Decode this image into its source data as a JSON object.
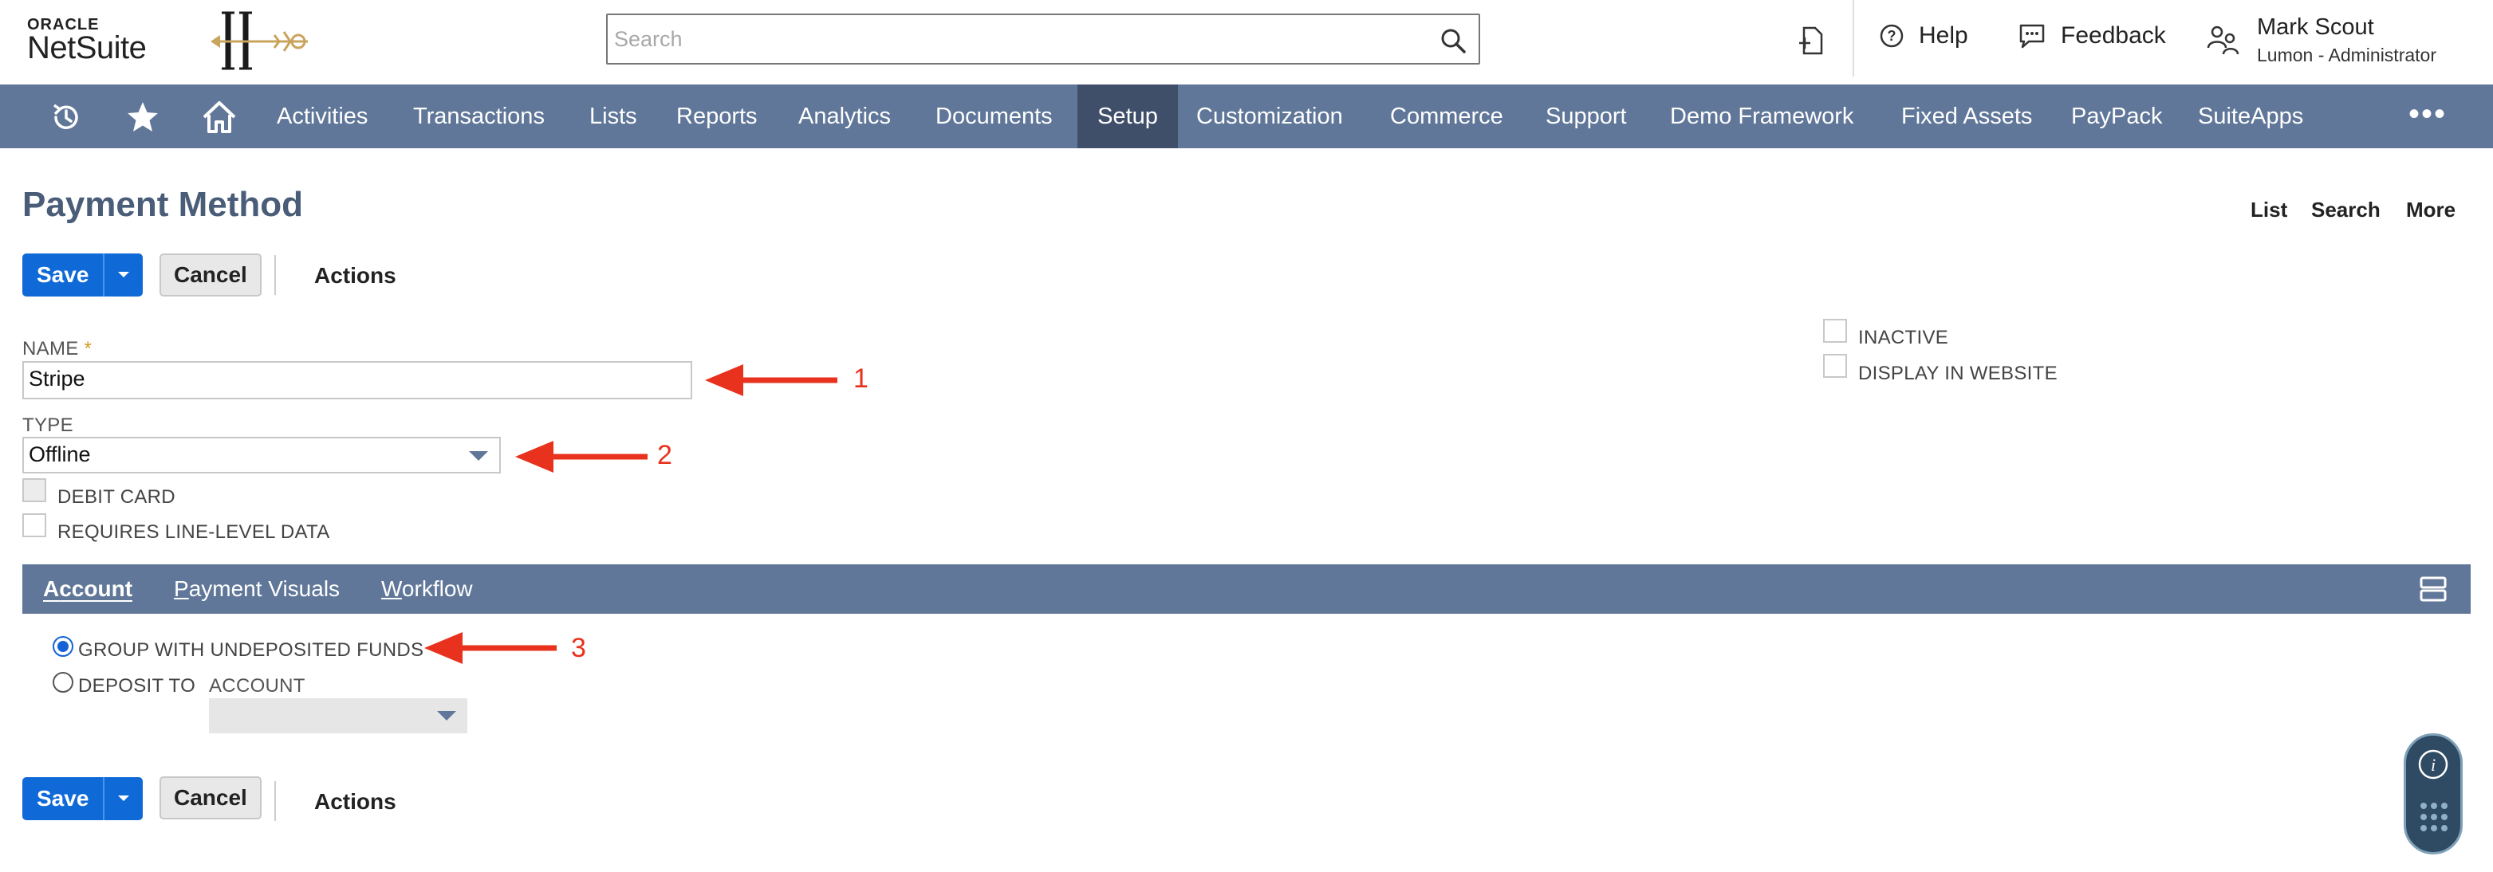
{
  "header": {
    "logo_oracle": "ORACLE",
    "logo_netsuite": "NetSuite",
    "search_placeholder": "Search",
    "help_label": "Help",
    "feedback_label": "Feedback",
    "user_name": "Mark Scout",
    "user_role": "Lumon - Administrator"
  },
  "nav": {
    "items": [
      "Activities",
      "Transactions",
      "Lists",
      "Reports",
      "Analytics",
      "Documents",
      "Setup",
      "Customization",
      "Commerce",
      "Support",
      "Demo Framework",
      "Fixed Assets",
      "PayPack",
      "SuiteApps"
    ],
    "active": "Setup",
    "more": "•••"
  },
  "page": {
    "title": "Payment Method",
    "links": [
      "List",
      "Search",
      "More"
    ]
  },
  "toolbar": {
    "save_label": "Save",
    "cancel_label": "Cancel",
    "actions_label": "Actions"
  },
  "form": {
    "name_label": "NAME",
    "name_required": "*",
    "name_value": "Stripe",
    "type_label": "TYPE",
    "type_value": "Offline",
    "debit_card_label": "DEBIT CARD",
    "requires_line_label": "REQUIRES LINE-LEVEL DATA",
    "inactive_label": "INACTIVE",
    "display_website_label": "DISPLAY IN WEBSITE"
  },
  "subtabs": {
    "items": [
      {
        "first": "A",
        "rest": "ccount"
      },
      {
        "first": "P",
        "rest": "ayment Visuals"
      },
      {
        "first": "W",
        "rest": "orkflow"
      }
    ],
    "active": "Account"
  },
  "account_tab": {
    "group_undeposited_label": "GROUP WITH UNDEPOSITED FUNDS",
    "deposit_to_label": "DEPOSIT TO",
    "account_label": "ACCOUNT",
    "group_undeposited_checked": true
  },
  "annotations": {
    "arrow_1": "1",
    "arrow_2": "2",
    "arrow_3": "3",
    "color": "#e8321e"
  },
  "colors": {
    "nav_bg": "#607799",
    "nav_active": "#3f4f6a",
    "primary_button": "#0f6ad8",
    "title": "#4a5d78"
  }
}
